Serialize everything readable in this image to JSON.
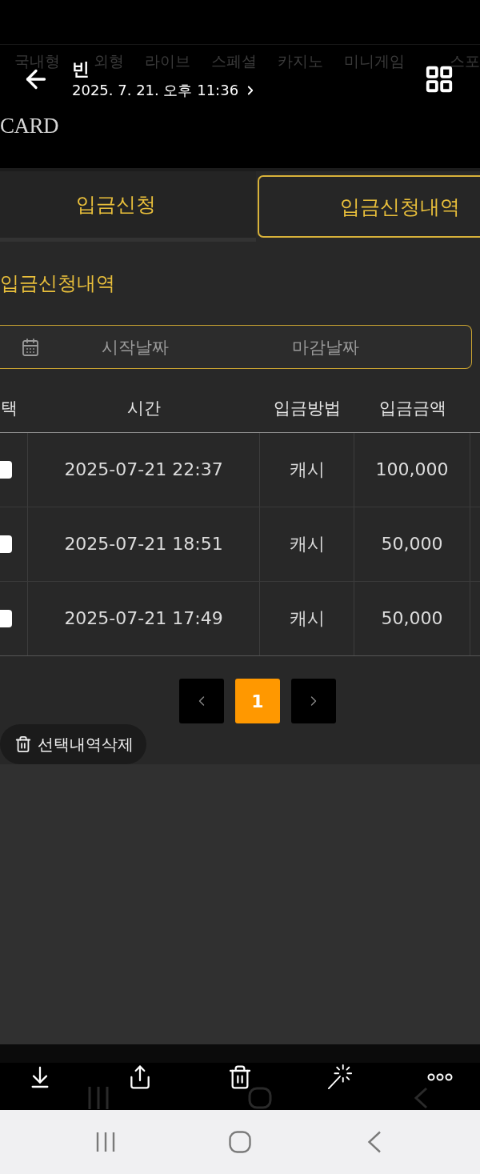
{
  "viewer": {
    "title": "빈",
    "date": "2025. 7. 21. 오후 11:36"
  },
  "site_nav": [
    "국내형",
    "외형",
    "라이브",
    "스페셜",
    "카지노",
    "미니게임",
    "스포"
  ],
  "logo": {
    "text": "CARD"
  },
  "tabs": [
    {
      "label": "입금신청",
      "selected": false
    },
    {
      "label": "입금신청내역",
      "selected": true
    }
  ],
  "section_title": "입금신청내역",
  "date_range": {
    "start_placeholder": "시작날짜",
    "end_placeholder": "마감날짜"
  },
  "table": {
    "select_column": "택",
    "columns": [
      "시간",
      "입금방법",
      "입금금액"
    ],
    "rows": [
      {
        "checked": false,
        "cells": [
          "2025-07-21 22:37",
          "캐시",
          "100,000"
        ]
      },
      {
        "checked": false,
        "cells": [
          "2025-07-21 18:51",
          "캐시",
          "50,000"
        ]
      },
      {
        "checked": false,
        "cells": [
          "2025-07-21 17:49",
          "캐시",
          "50,000"
        ]
      }
    ]
  },
  "pagination": {
    "pages": [
      {
        "label": "1",
        "selected": true
      }
    ]
  },
  "delete_button": {
    "label": "선택내역삭제"
  }
}
